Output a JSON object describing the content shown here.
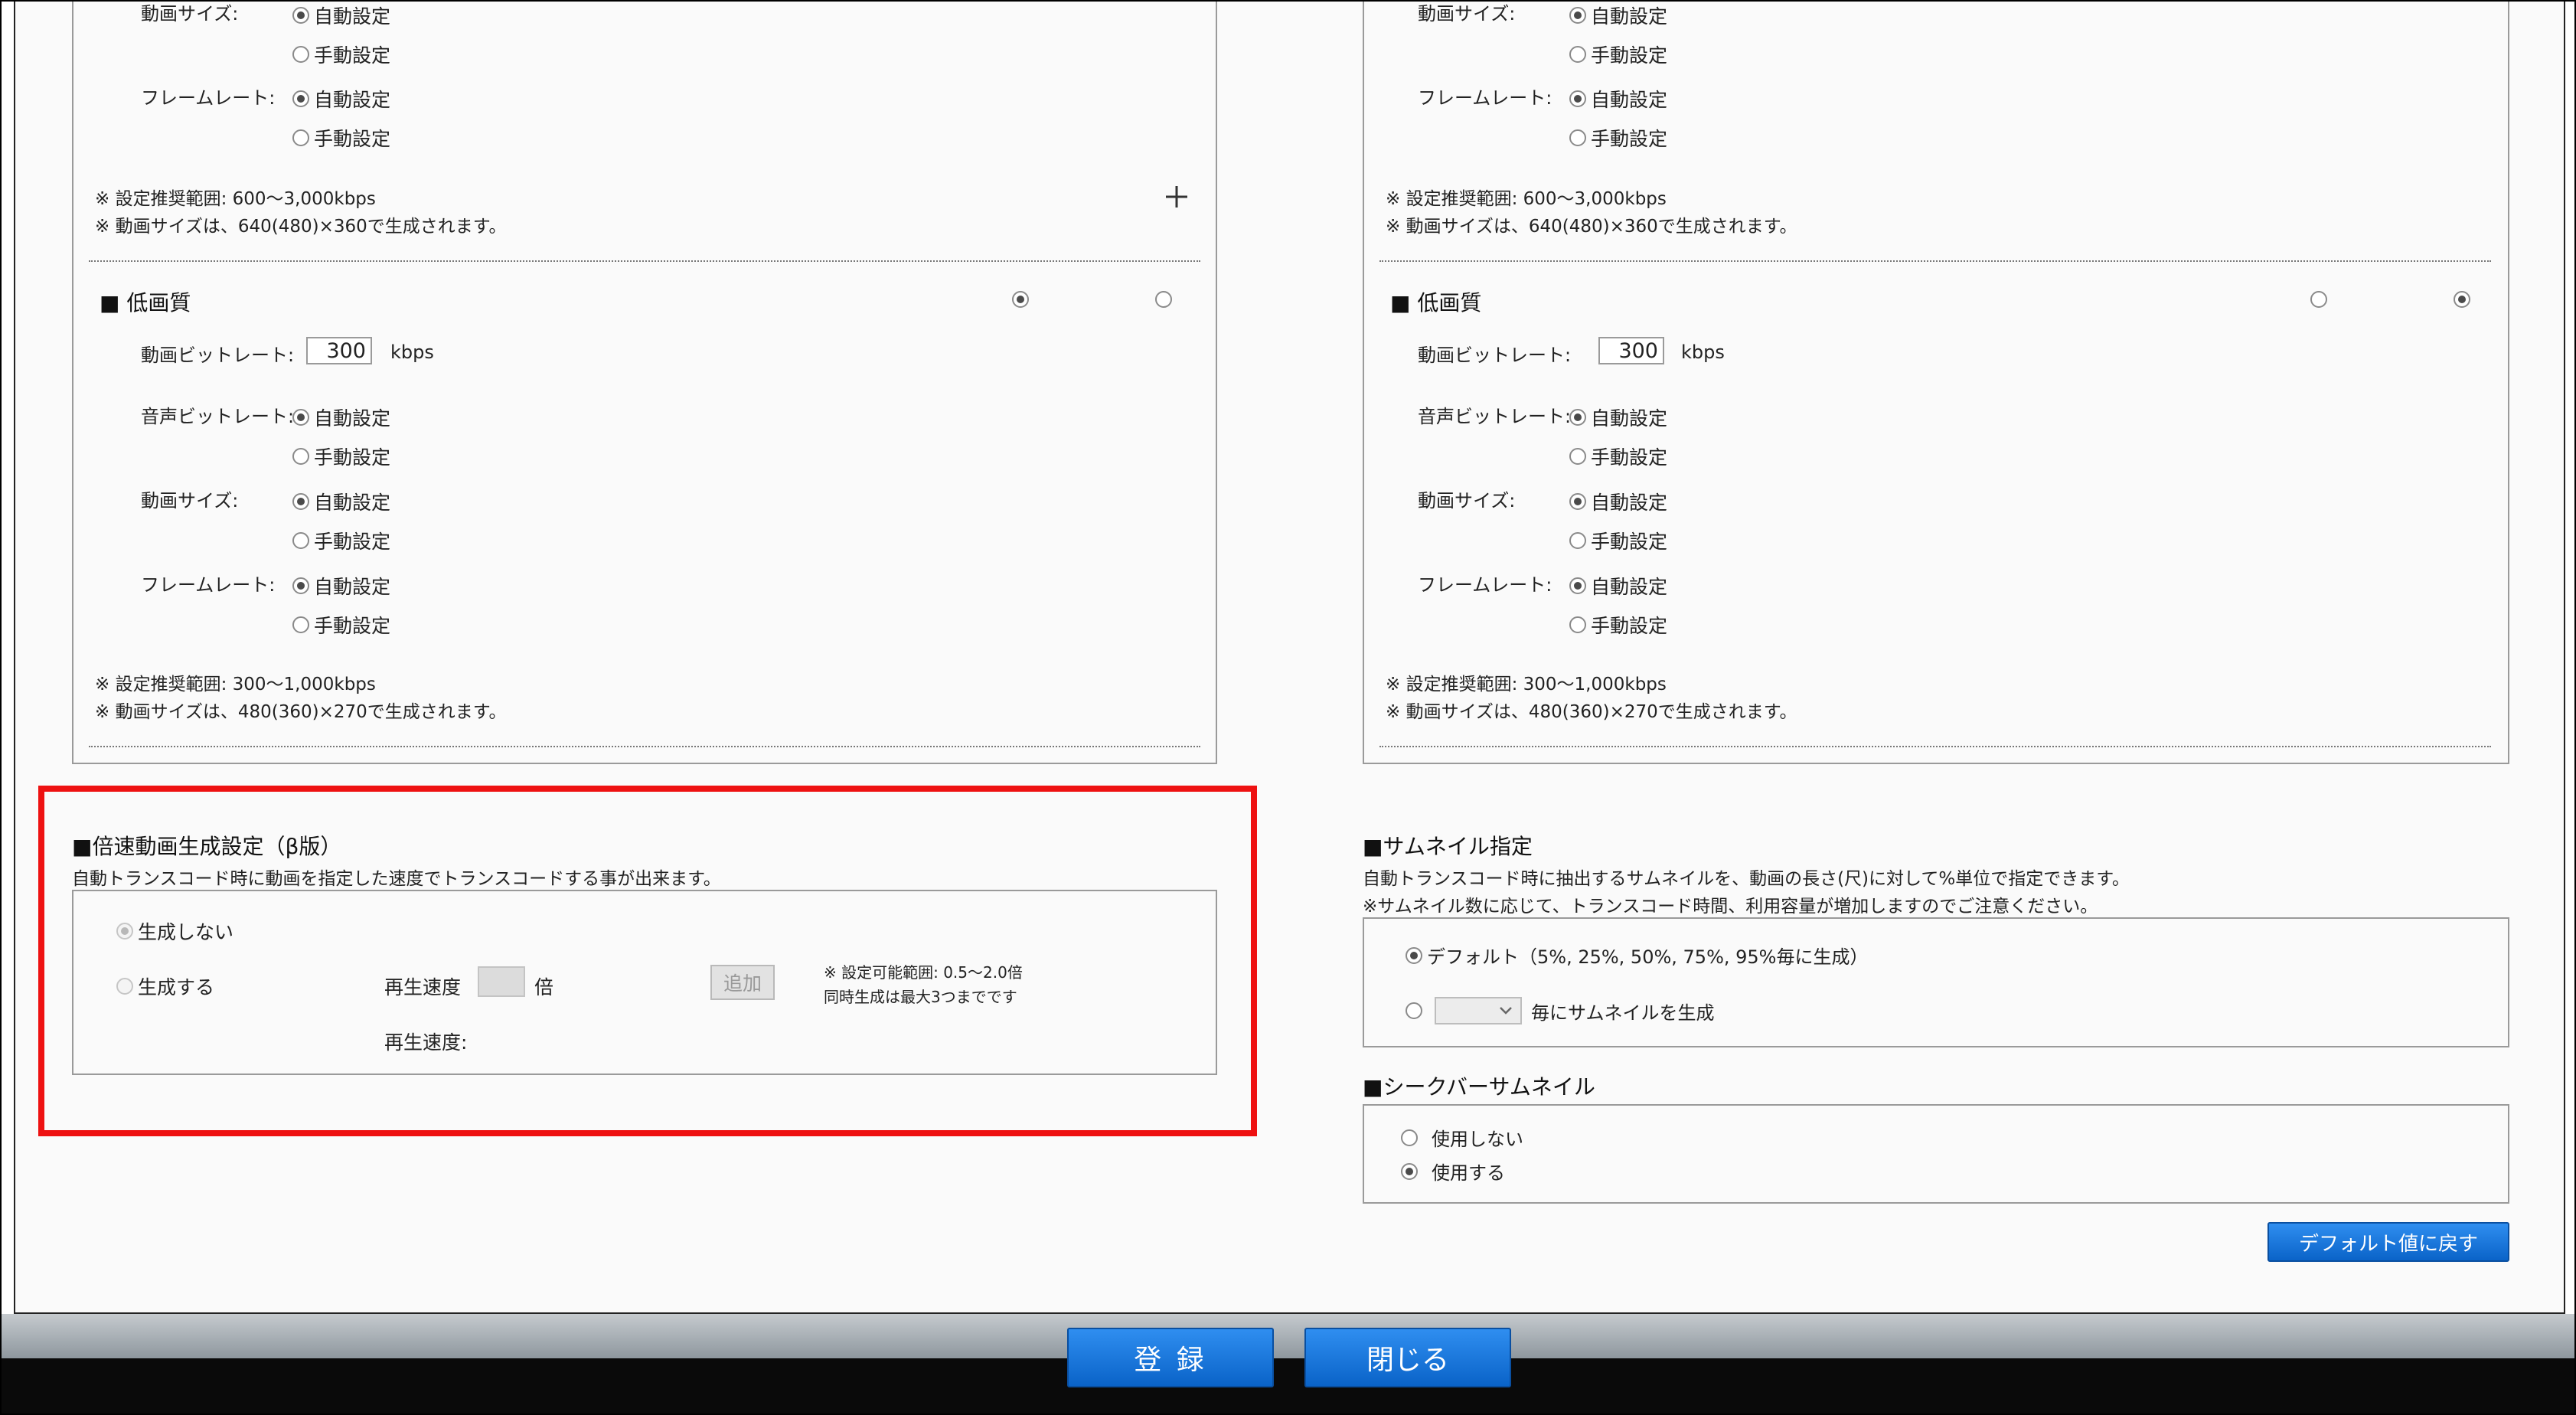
{
  "left_panel": {
    "top_block": {
      "video_size_label": "動画サイズ:",
      "video_size_options": [
        "自動設定",
        "手動設定"
      ],
      "framerate_label": "フレームレート:",
      "framerate_options": [
        "自動設定",
        "手動設定"
      ],
      "note1": "※ 設定推奨範囲: 600～3,000kbps",
      "note2": "※ 動画サイズは、640(480)×360で生成されます。"
    },
    "low_quality": {
      "title": "■ 低画質",
      "video_bitrate_label": "動画ビットレート:",
      "video_bitrate_value": "300",
      "unit": "kbps",
      "audio_bitrate_label": "音声ビットレート:",
      "audio_options": [
        "自動設定",
        "手動設定"
      ],
      "video_size_label": "動画サイズ:",
      "video_size_options": [
        "自動設定",
        "手動設定"
      ],
      "framerate_label": "フレームレート:",
      "framerate_options": [
        "自動設定",
        "手動設定"
      ],
      "note1": "※ 設定推奨範囲: 300～1,000kbps",
      "note2": "※ 動画サイズは、480(360)×270で生成されます。"
    }
  },
  "right_panel": {
    "top_block": {
      "video_size_label": "動画サイズ:",
      "video_size_options": [
        "自動設定",
        "手動設定"
      ],
      "framerate_label": "フレームレート:",
      "framerate_options": [
        "自動設定",
        "手動設定"
      ],
      "note1": "※ 設定推奨範囲: 600～3,000kbps",
      "note2": "※ 動画サイズは、640(480)×360で生成されます。"
    },
    "low_quality": {
      "title": "■ 低画質",
      "video_bitrate_label": "動画ビットレート:",
      "video_bitrate_value": "300",
      "unit": "kbps",
      "audio_bitrate_label": "音声ビットレート:",
      "audio_options": [
        "自動設定",
        "手動設定"
      ],
      "video_size_label": "動画サイズ:",
      "video_size_options": [
        "自動設定",
        "手動設定"
      ],
      "framerate_label": "フレームレート:",
      "framerate_options": [
        "自動設定",
        "手動設定"
      ],
      "note1": "※ 設定推奨範囲: 300～1,000kbps",
      "note2": "※ 動画サイズは、480(360)×270で生成されます。"
    }
  },
  "speed_section": {
    "title": "■倍速動画生成設定（β版）",
    "subtitle": "自動トランスコード時に動画を指定した速度でトランスコードする事が出来ます。",
    "opt_none": "生成しない",
    "opt_generate": "生成する",
    "speed_label": "再生速度",
    "speed_unit": "倍",
    "add_button": "追加",
    "note1": "※ 設定可能範囲: 0.5～2.0倍",
    "note2": "同時生成は最大3つまでです",
    "speed_list_label": "再生速度:"
  },
  "thumbnail_section": {
    "title": "■サムネイル指定",
    "subtitle1": "自動トランスコード時に抽出するサムネイルを、動画の長さ(尺)に対して%単位で指定できます。",
    "subtitle2": "※サムネイル数に応じて、トランスコード時間、利用容量が増加しますのでご注意ください。",
    "opt_default": "デフォルト（5%, 25%, 50%, 75%, 95%毎に生成）",
    "opt_custom_suffix": "毎にサムネイルを生成"
  },
  "seekbar_section": {
    "title": "■シークバーサムネイル",
    "opt_off": "使用しない",
    "opt_on": "使用する"
  },
  "reset_button": "デフォルト値に戻す",
  "footer": {
    "register_button": "登 録",
    "close_button": "閉じる"
  },
  "colors": {
    "highlight_border": "#ee1111",
    "button_blue": "#0a63c8"
  },
  "icons": {
    "expand": "plus-icon",
    "dropdown": "chevron-down-icon"
  }
}
